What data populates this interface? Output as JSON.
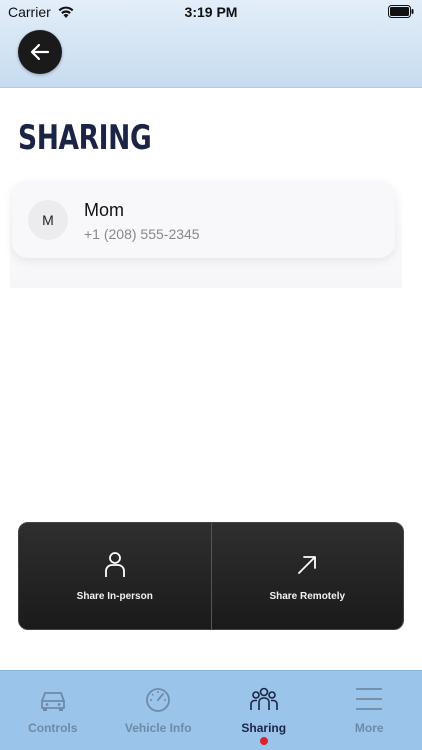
{
  "status_bar": {
    "carrier": "Carrier",
    "time": "3:19 PM"
  },
  "header": {
    "back_icon": "arrow-left-icon"
  },
  "page": {
    "title": "SHARING"
  },
  "contact": {
    "initial": "M",
    "name": "Mom",
    "phone": "+1 (208) 555-2345"
  },
  "share_options": [
    {
      "label": "Share In-person",
      "icon": "person-icon"
    },
    {
      "label": "Share Remotely",
      "icon": "arrow-up-right-icon"
    }
  ],
  "tabs": [
    {
      "label": "Controls",
      "icon": "car-icon",
      "active": false
    },
    {
      "label": "Vehicle Info",
      "icon": "speedometer-icon",
      "active": false
    },
    {
      "label": "Sharing",
      "icon": "people-icon",
      "active": true
    },
    {
      "label": "More",
      "icon": "menu-icon",
      "active": false
    }
  ],
  "colors": {
    "accent_navy": "#1c2445",
    "tab_bar": "#9bc4ea",
    "active_dot": "#d8232a",
    "share_panel": "#1a1a1a"
  }
}
